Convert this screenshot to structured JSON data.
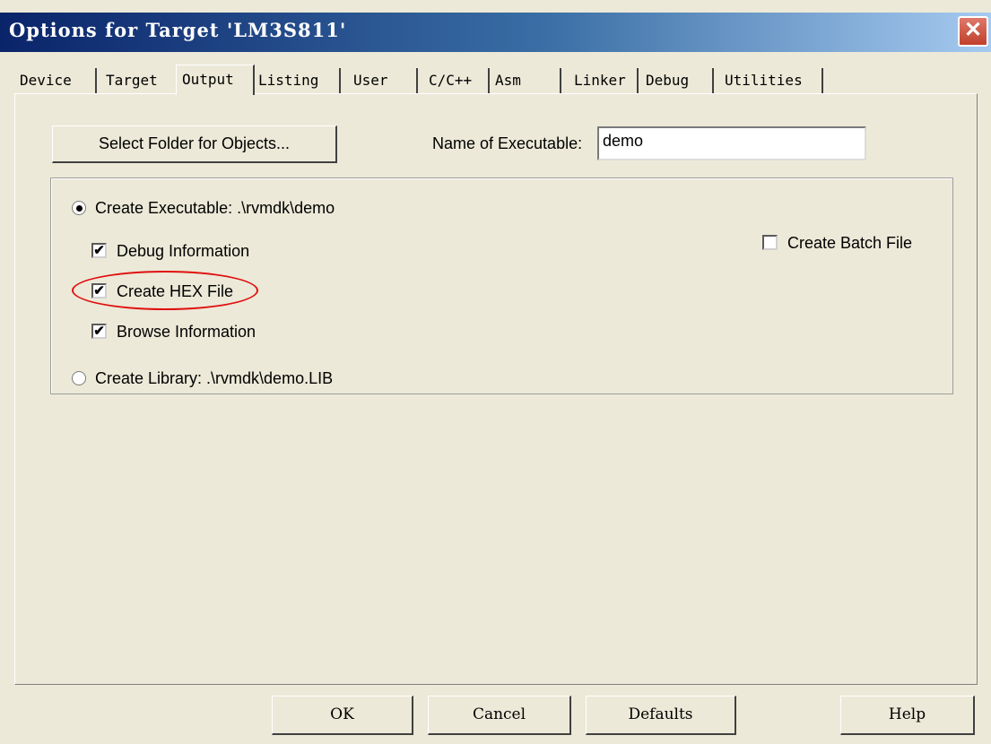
{
  "window": {
    "title": "Options for Target 'LM3S811'",
    "close_glyph": "✕"
  },
  "tabs": [
    {
      "label": "Device",
      "active": false
    },
    {
      "label": "Target",
      "active": false
    },
    {
      "label": "Output",
      "active": true
    },
    {
      "label": "Listing",
      "active": false
    },
    {
      "label": "User",
      "active": false
    },
    {
      "label": "C/C++",
      "active": false
    },
    {
      "label": "Asm",
      "active": false
    },
    {
      "label": "Linker",
      "active": false
    },
    {
      "label": "Debug",
      "active": false
    },
    {
      "label": "Utilities",
      "active": false
    }
  ],
  "output": {
    "select_folder_label": "Select Folder for Objects...",
    "name_of_executable_label": "Name of Executable:",
    "name_of_executable_value": "demo",
    "create_executable_label": "Create Executable:  .\\rvmdk\\demo",
    "create_executable_selected": true,
    "debug_information_label": "Debug Information",
    "debug_information_checked": true,
    "create_hex_label": "Create HEX File",
    "create_hex_checked": true,
    "browse_information_label": "Browse Information",
    "browse_information_checked": true,
    "create_library_label": "Create Library:  .\\rvmdk\\demo.LIB",
    "create_library_selected": false,
    "create_batch_label": "Create Batch File",
    "create_batch_checked": false,
    "check_glyph": "✔"
  },
  "buttons": {
    "ok": "OK",
    "cancel": "Cancel",
    "defaults": "Defaults",
    "help": "Help"
  },
  "colors": {
    "title_gradient_start": "#0a246a",
    "title_gradient_end": "#a6caf0",
    "dialog_bg": "#ece9d8",
    "highlight": "#e01010"
  }
}
